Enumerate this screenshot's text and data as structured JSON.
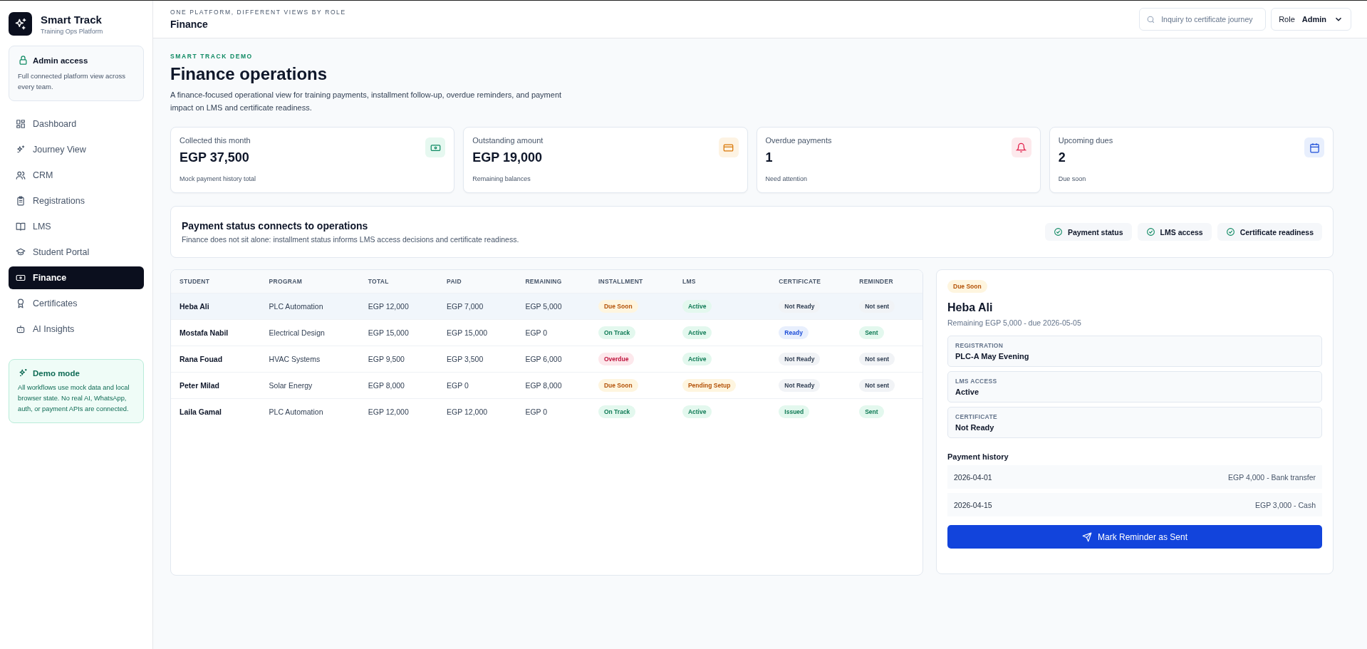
{
  "brand": {
    "name": "Smart Track",
    "tagline": "Training Ops Platform"
  },
  "access": {
    "title": "Admin access",
    "text": "Full connected platform view across every team."
  },
  "nav": [
    {
      "label": "Dashboard",
      "selected": false
    },
    {
      "label": "Journey View",
      "selected": false
    },
    {
      "label": "CRM",
      "selected": false
    },
    {
      "label": "Registrations",
      "selected": false
    },
    {
      "label": "LMS",
      "selected": false
    },
    {
      "label": "Student Portal",
      "selected": false
    },
    {
      "label": "Finance",
      "selected": true
    },
    {
      "label": "Certificates",
      "selected": false
    },
    {
      "label": "AI Insights",
      "selected": false
    }
  ],
  "demo": {
    "title": "Demo mode",
    "text": "All workflows use mock data and local browser state. No real AI, WhatsApp, auth, or payment APIs are connected."
  },
  "header": {
    "eyebrow": "ONE PLATFORM, DIFFERENT VIEWS BY ROLE",
    "title": "Finance",
    "search_placeholder": "Inquiry to certificate journey",
    "role_label": "Role",
    "role_value": "Admin"
  },
  "page": {
    "eyebrow": "SMART TRACK DEMO",
    "title": "Finance operations",
    "description": "A finance-focused operational view for training payments, installment follow-up, overdue reminders, and payment impact on LMS and certificate readiness."
  },
  "stats": [
    {
      "label": "Collected this month",
      "value": "EGP 37,500",
      "note": "Mock payment history total",
      "kind": "money"
    },
    {
      "label": "Outstanding amount",
      "value": "EGP 19,000",
      "note": "Remaining balances",
      "kind": "card"
    },
    {
      "label": "Overdue payments",
      "value": "1",
      "note": "Need attention",
      "kind": "bell"
    },
    {
      "label": "Upcoming dues",
      "value": "2",
      "note": "Due soon",
      "kind": "calendar"
    }
  ],
  "connect": {
    "title": "Payment status connects to operations",
    "text": "Finance does not sit alone: installment status informs LMS access decisions and certificate readiness.",
    "chips": [
      "Payment status",
      "LMS access",
      "Certificate readiness"
    ]
  },
  "table": {
    "columns": [
      "STUDENT",
      "PROGRAM",
      "TOTAL",
      "PAID",
      "REMAINING",
      "INSTALLMENT",
      "LMS",
      "CERTIFICATE",
      "REMINDER"
    ],
    "rows": [
      {
        "selected": true,
        "student": "Heba Ali",
        "program": "PLC Automation",
        "total": "EGP 12,000",
        "paid": "EGP 7,000",
        "remaining": "EGP 5,000",
        "installment": {
          "text": "Due Soon",
          "kind": "warning"
        },
        "lms": {
          "text": "Active",
          "kind": "success"
        },
        "certificate": {
          "text": "Not Ready",
          "kind": "neutral"
        },
        "reminder": {
          "text": "Not sent",
          "kind": "neutral"
        }
      },
      {
        "selected": false,
        "student": "Mostafa Nabil",
        "program": "Electrical Design",
        "total": "EGP 15,000",
        "paid": "EGP 15,000",
        "remaining": "EGP 0",
        "installment": {
          "text": "On Track",
          "kind": "success"
        },
        "lms": {
          "text": "Active",
          "kind": "success"
        },
        "certificate": {
          "text": "Ready",
          "kind": "info"
        },
        "reminder": {
          "text": "Sent",
          "kind": "success"
        }
      },
      {
        "selected": false,
        "student": "Rana Fouad",
        "program": "HVAC Systems",
        "total": "EGP 9,500",
        "paid": "EGP 3,500",
        "remaining": "EGP 6,000",
        "installment": {
          "text": "Overdue",
          "kind": "danger"
        },
        "lms": {
          "text": "Active",
          "kind": "success"
        },
        "certificate": {
          "text": "Not Ready",
          "kind": "neutral"
        },
        "reminder": {
          "text": "Not sent",
          "kind": "neutral"
        }
      },
      {
        "selected": false,
        "student": "Peter Milad",
        "program": "Solar Energy",
        "total": "EGP 8,000",
        "paid": "EGP 0",
        "remaining": "EGP 8,000",
        "installment": {
          "text": "Due Soon",
          "kind": "warning"
        },
        "lms": {
          "text": "Pending Setup",
          "kind": "warning"
        },
        "certificate": {
          "text": "Not Ready",
          "kind": "neutral"
        },
        "reminder": {
          "text": "Not sent",
          "kind": "neutral"
        }
      },
      {
        "selected": false,
        "student": "Laila Gamal",
        "program": "PLC Automation",
        "total": "EGP 12,000",
        "paid": "EGP 12,000",
        "remaining": "EGP 0",
        "installment": {
          "text": "On Track",
          "kind": "success"
        },
        "lms": {
          "text": "Active",
          "kind": "success"
        },
        "certificate": {
          "text": "Issued",
          "kind": "success"
        },
        "reminder": {
          "text": "Sent",
          "kind": "success"
        }
      }
    ]
  },
  "detail": {
    "badge": {
      "text": "Due Soon",
      "kind": "warning"
    },
    "name": "Heba Ali",
    "subtitle": "Remaining EGP 5,000 - due 2026-05-05",
    "fields": [
      {
        "label": "REGISTRATION",
        "value": "PLC-A May Evening"
      },
      {
        "label": "LMS ACCESS",
        "value": "Active"
      },
      {
        "label": "CERTIFICATE",
        "value": "Not Ready"
      }
    ],
    "history_title": "Payment history",
    "history": [
      {
        "date": "2026-04-01",
        "info": "EGP 4,000 - Bank transfer"
      },
      {
        "date": "2026-04-15",
        "info": "EGP 3,000 - Cash"
      }
    ],
    "action": "Mark Reminder as Sent"
  }
}
